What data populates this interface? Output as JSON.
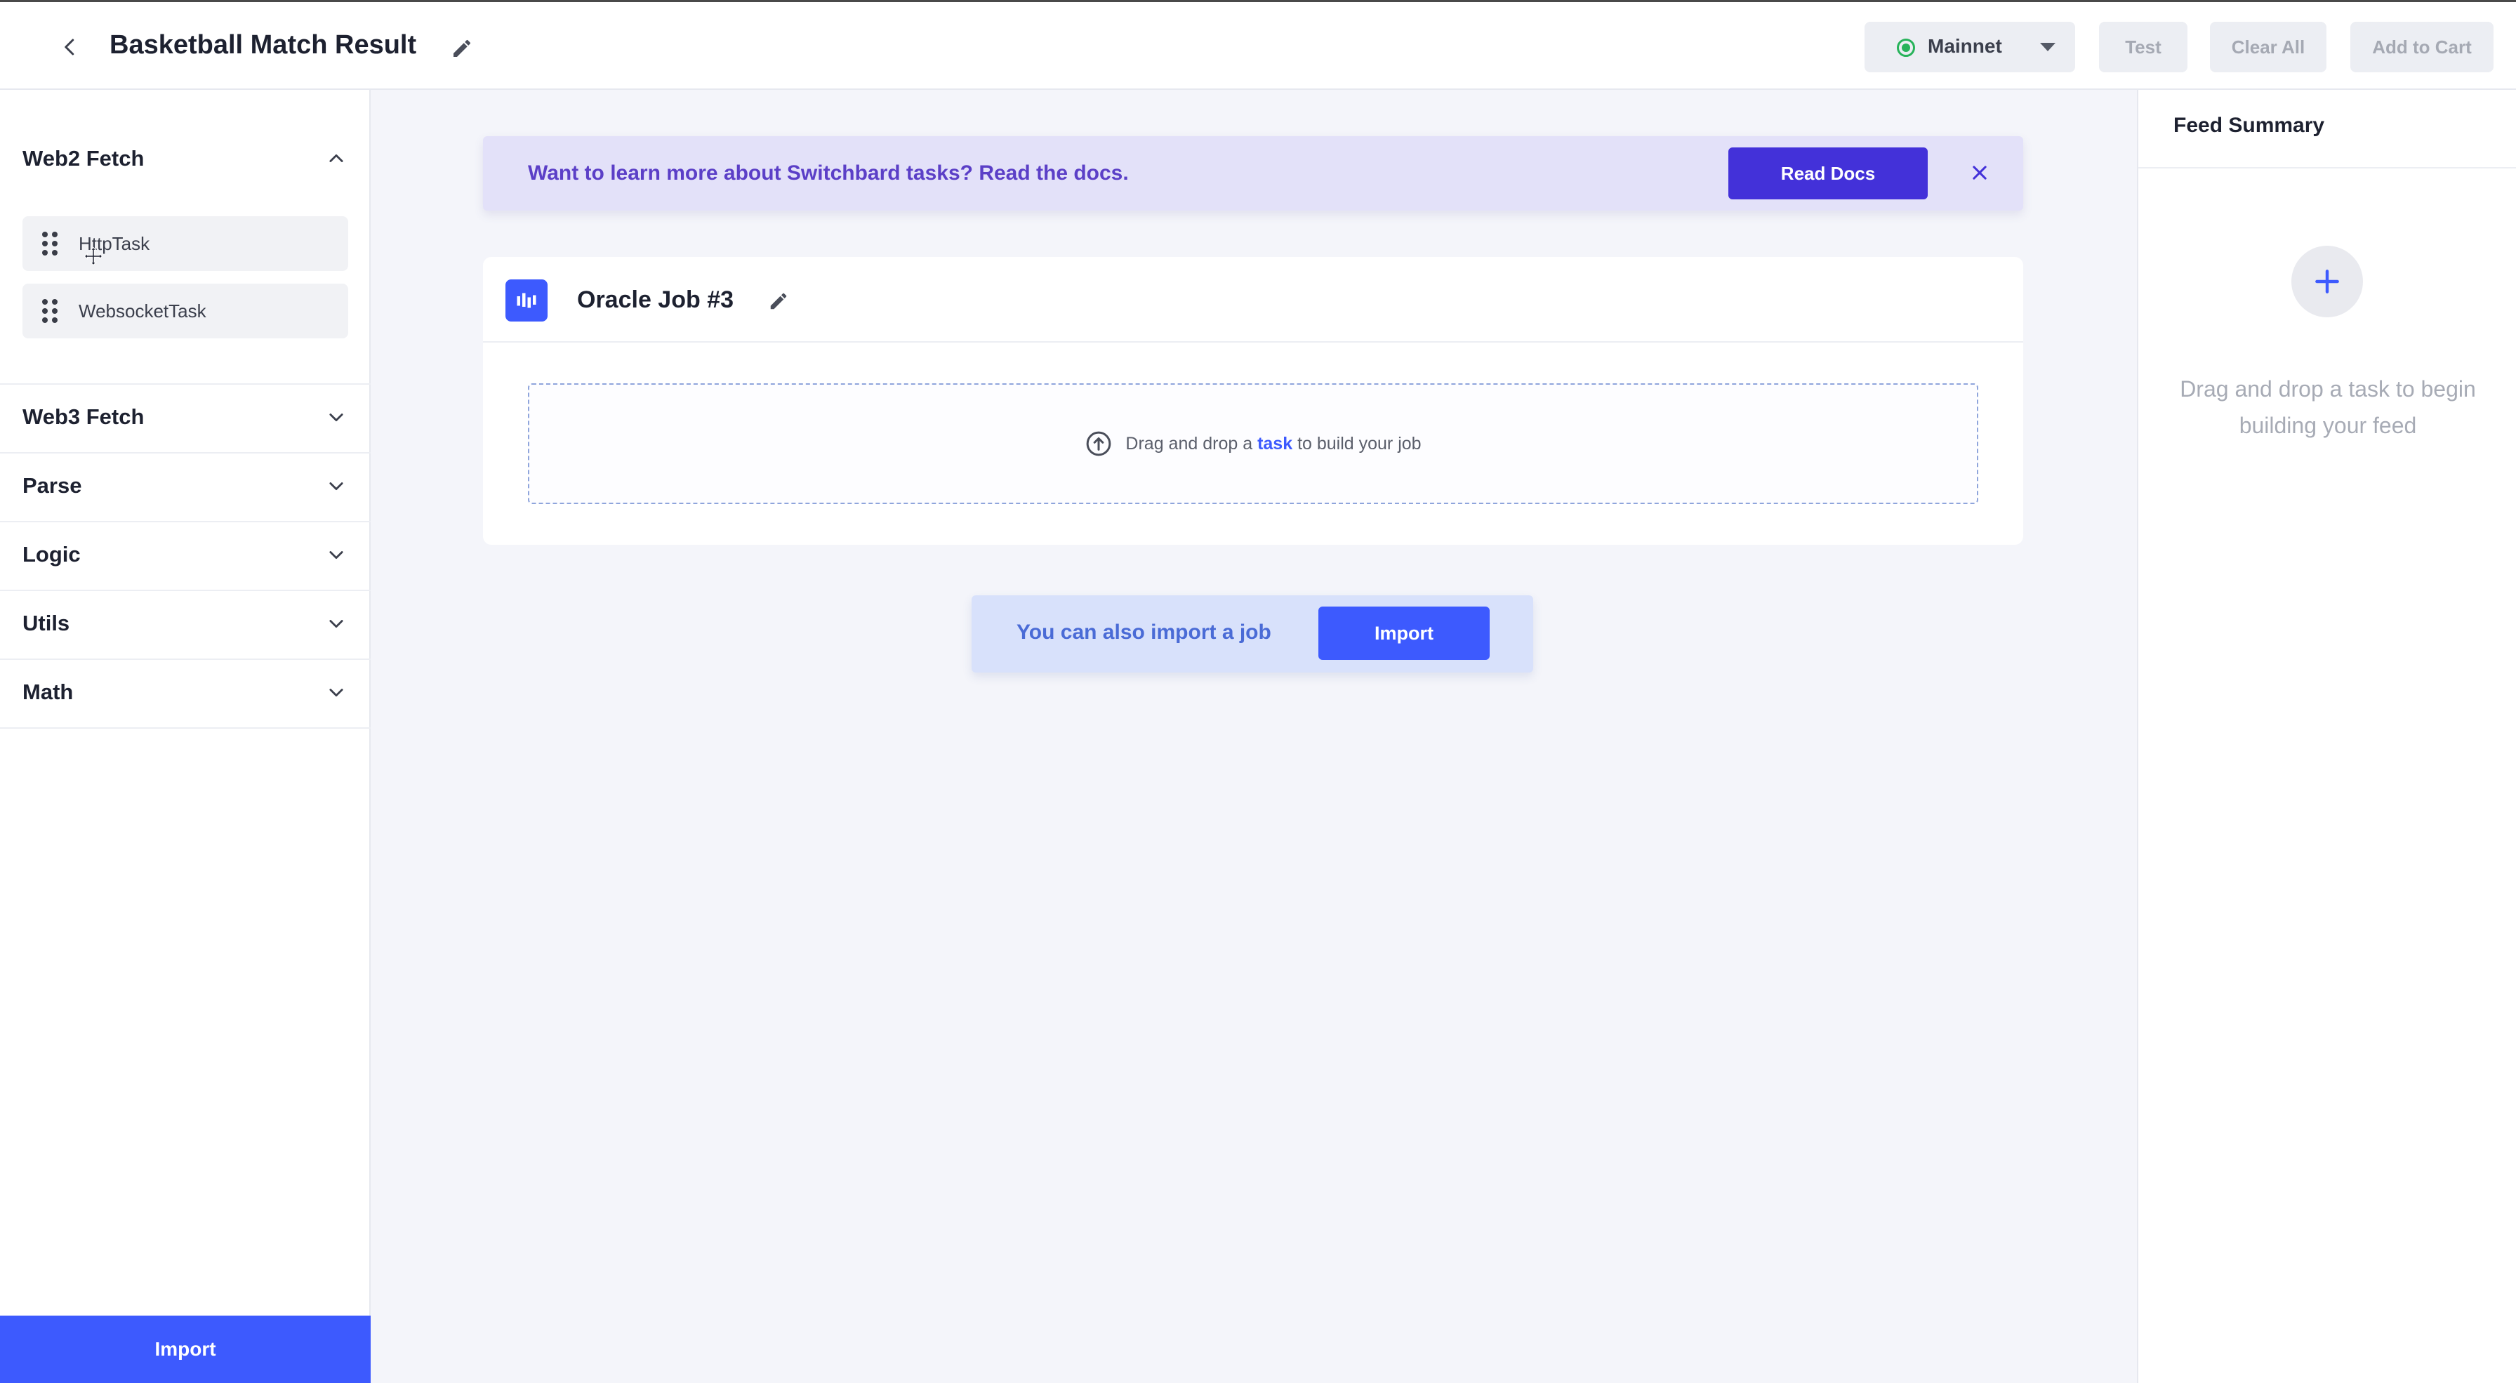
{
  "header": {
    "title": "Basketball Match Result",
    "network": "Mainnet",
    "test_label": "Test",
    "clear_label": "Clear All",
    "cart_label": "Add to Cart"
  },
  "sidebar": {
    "sections": [
      {
        "title": "Web2 Fetch",
        "expanded": true,
        "items": [
          "HttpTask",
          "WebsocketTask"
        ]
      },
      {
        "title": "Web3 Fetch",
        "expanded": false
      },
      {
        "title": "Parse",
        "expanded": false
      },
      {
        "title": "Logic",
        "expanded": false
      },
      {
        "title": "Utils",
        "expanded": false
      },
      {
        "title": "Math",
        "expanded": false
      }
    ],
    "import_label": "Import"
  },
  "banner": {
    "text": "Want to learn more about Switchbard tasks? Read the docs.",
    "button_label": "Read Docs"
  },
  "job": {
    "title": "Oracle Job #3",
    "drop_prefix": "Drag and drop a",
    "drop_link": "task",
    "drop_suffix": "to build your job"
  },
  "import_prompt": {
    "text": "You can also import a job",
    "button_label": "Import"
  },
  "summary": {
    "title": "Feed Summary",
    "empty_message": "Drag and drop a task to begin building your feed"
  },
  "colors": {
    "accent": "#3d5afe",
    "banner_bg": "#e3e1f9",
    "banner_text": "#5b3fc7",
    "network_status": "#27b35a"
  }
}
